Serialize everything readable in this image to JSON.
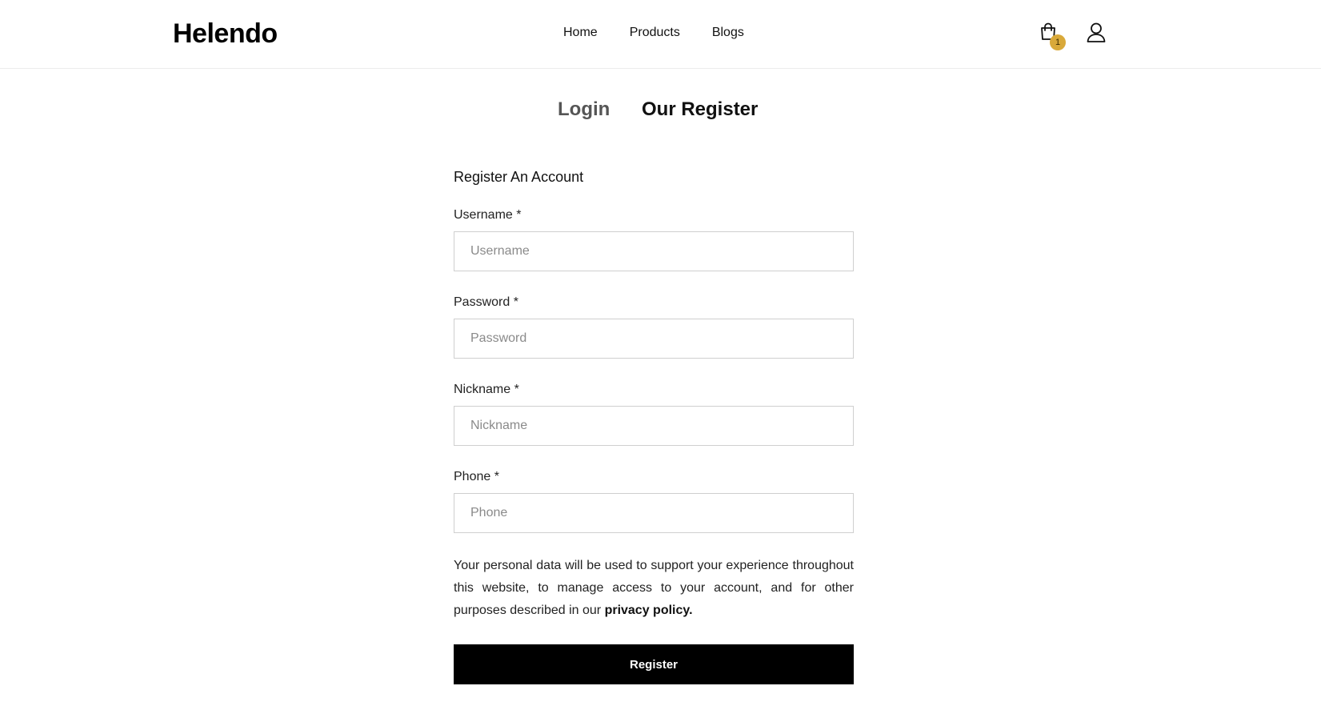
{
  "header": {
    "logo": "Helendo",
    "nav": [
      {
        "label": "Home"
      },
      {
        "label": "Products"
      },
      {
        "label": "Blogs"
      }
    ],
    "cart": {
      "icon": "shopping-bag-icon",
      "count": "1",
      "badge_color": "#d9a93a"
    },
    "user": {
      "icon": "user-icon"
    }
  },
  "tabs": {
    "login": "Login",
    "register": "Our Register",
    "active": "register"
  },
  "form": {
    "title": "Register An Account",
    "fields": {
      "username": {
        "label": "Username *",
        "placeholder": "Username",
        "value": ""
      },
      "password": {
        "label": "Password *",
        "placeholder": "Password",
        "value": ""
      },
      "nickname": {
        "label": "Nickname *",
        "placeholder": "Nickname",
        "value": ""
      },
      "phone": {
        "label": "Phone *",
        "placeholder": "Phone",
        "value": ""
      }
    },
    "privacy_text": "Your personal data will be used to support your experience throughout this website, to manage access to your account, and for other purposes described in our",
    "privacy_link": "privacy policy.",
    "submit_label": "Register",
    "submit_color": "#000000"
  }
}
